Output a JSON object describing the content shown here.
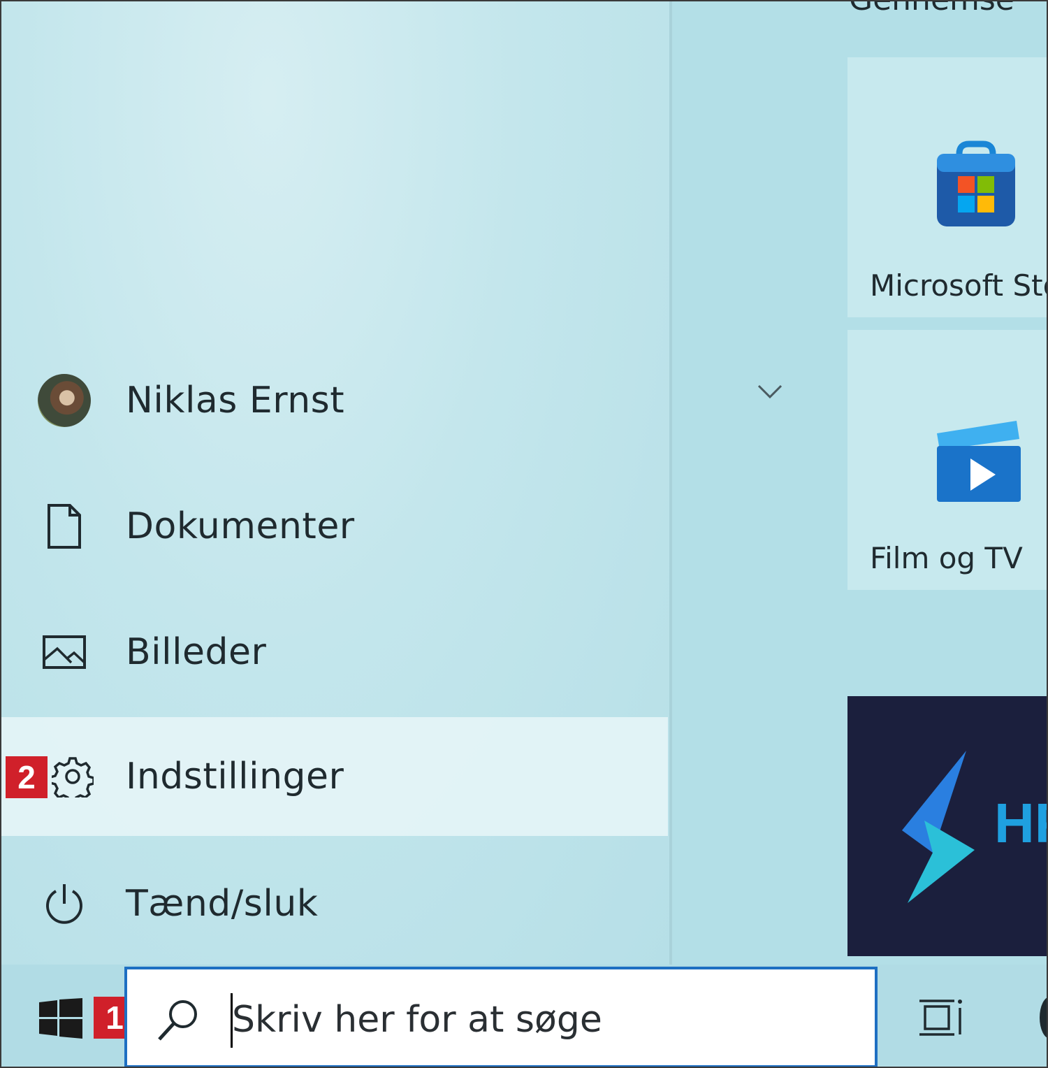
{
  "start_menu": {
    "user": {
      "name": "Niklas Ernst"
    },
    "items": [
      {
        "label": "Dokumenter",
        "icon": "document-icon"
      },
      {
        "label": "Billeder",
        "icon": "pictures-icon"
      },
      {
        "label": "Indstillinger",
        "icon": "gear-icon"
      },
      {
        "label": "Tænd/sluk",
        "icon": "power-icon"
      }
    ]
  },
  "tiles": {
    "group_title": "Gennemse",
    "store": {
      "label": "Microsoft Sto"
    },
    "film": {
      "label": "Film og TV"
    },
    "hp": {
      "label": "HP"
    }
  },
  "taskbar": {
    "search_placeholder": "Skriv her for at søge"
  },
  "callouts": {
    "one": "1",
    "two": "2"
  },
  "colors": {
    "badge": "#d0202a",
    "search_border": "#1e6fc2",
    "pane_bg": "#c3e6ec",
    "hp_tile_bg": "#1b1f3d"
  }
}
